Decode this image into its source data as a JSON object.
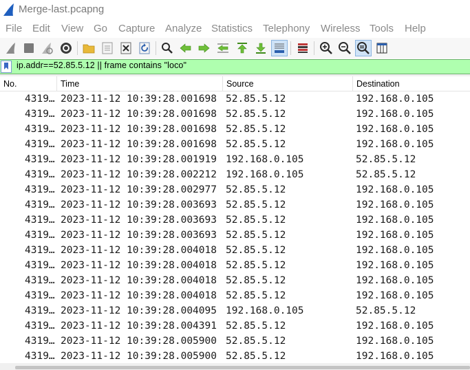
{
  "window": {
    "title": "Merge-last.pcapng"
  },
  "menu": [
    "File",
    "Edit",
    "View",
    "Go",
    "Capture",
    "Analyze",
    "Statistics",
    "Telephony",
    "Wireless",
    "Tools",
    "Help"
  ],
  "filter": {
    "text": "ip.addr==52.85.5.12 || frame contains \"loco\""
  },
  "columns": [
    "No.",
    "Time",
    "Source",
    "Destination"
  ],
  "packets": [
    {
      "no": "4319…",
      "time": "2023-11-12 10:39:28.001698",
      "source": "52.85.5.12",
      "destination": "192.168.0.105"
    },
    {
      "no": "4319…",
      "time": "2023-11-12 10:39:28.001698",
      "source": "52.85.5.12",
      "destination": "192.168.0.105"
    },
    {
      "no": "4319…",
      "time": "2023-11-12 10:39:28.001698",
      "source": "52.85.5.12",
      "destination": "192.168.0.105"
    },
    {
      "no": "4319…",
      "time": "2023-11-12 10:39:28.001698",
      "source": "52.85.5.12",
      "destination": "192.168.0.105"
    },
    {
      "no": "4319…",
      "time": "2023-11-12 10:39:28.001919",
      "source": "192.168.0.105",
      "destination": "52.85.5.12"
    },
    {
      "no": "4319…",
      "time": "2023-11-12 10:39:28.002212",
      "source": "192.168.0.105",
      "destination": "52.85.5.12"
    },
    {
      "no": "4319…",
      "time": "2023-11-12 10:39:28.002977",
      "source": "52.85.5.12",
      "destination": "192.168.0.105"
    },
    {
      "no": "4319…",
      "time": "2023-11-12 10:39:28.003693",
      "source": "52.85.5.12",
      "destination": "192.168.0.105"
    },
    {
      "no": "4319…",
      "time": "2023-11-12 10:39:28.003693",
      "source": "52.85.5.12",
      "destination": "192.168.0.105"
    },
    {
      "no": "4319…",
      "time": "2023-11-12 10:39:28.003693",
      "source": "52.85.5.12",
      "destination": "192.168.0.105"
    },
    {
      "no": "4319…",
      "time": "2023-11-12 10:39:28.004018",
      "source": "52.85.5.12",
      "destination": "192.168.0.105"
    },
    {
      "no": "4319…",
      "time": "2023-11-12 10:39:28.004018",
      "source": "52.85.5.12",
      "destination": "192.168.0.105"
    },
    {
      "no": "4319…",
      "time": "2023-11-12 10:39:28.004018",
      "source": "52.85.5.12",
      "destination": "192.168.0.105"
    },
    {
      "no": "4319…",
      "time": "2023-11-12 10:39:28.004018",
      "source": "52.85.5.12",
      "destination": "192.168.0.105"
    },
    {
      "no": "4319…",
      "time": "2023-11-12 10:39:28.004095",
      "source": "192.168.0.105",
      "destination": "52.85.5.12"
    },
    {
      "no": "4319…",
      "time": "2023-11-12 10:39:28.004391",
      "source": "52.85.5.12",
      "destination": "192.168.0.105"
    },
    {
      "no": "4319…",
      "time": "2023-11-12 10:39:28.005900",
      "source": "52.85.5.12",
      "destination": "192.168.0.105"
    },
    {
      "no": "4319…",
      "time": "2023-11-12 10:39:28.005900",
      "source": "52.85.5.12",
      "destination": "192.168.0.105"
    }
  ],
  "colors": {
    "filter_valid_bg": "#afffaf",
    "accent_blue": "#1f5fbf"
  },
  "toolbar_icons": [
    "shark-fin-start-icon",
    "stop-icon",
    "restart-icon",
    "options-gear-icon",
    "open-folder-icon",
    "file-set-icon",
    "close-file-icon",
    "reload-icon",
    "find-icon",
    "go-back-icon",
    "go-forward-icon",
    "go-to-packet-icon",
    "go-first-icon",
    "go-last-icon",
    "autoscroll-icon",
    "colorize-icon",
    "zoom-in-icon",
    "zoom-out-icon",
    "zoom-normal-icon",
    "resize-columns-icon"
  ]
}
